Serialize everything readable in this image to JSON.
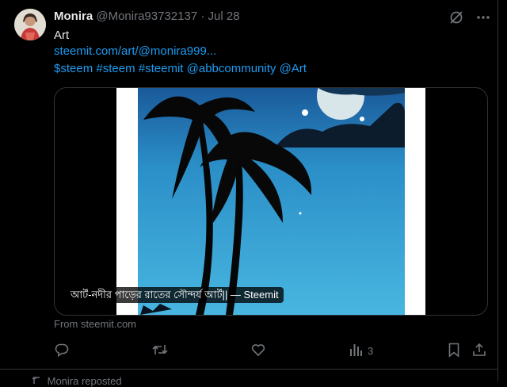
{
  "tweet": {
    "author_name": "Monira",
    "handle": "@Monira93732137",
    "separator": "·",
    "date": "Jul 28",
    "text": "Art",
    "link": "steemit.com/art/@monira999...",
    "tags": [
      "$steem",
      "#steem",
      "#steemit",
      "@abbcommunity",
      "@Art"
    ],
    "media_caption": "আর্ট-নদীর পাড়ের রাতের সৌন্দর্য আর্ট|| — Steemit",
    "from_text": "From steemit.com",
    "views": "3"
  },
  "next_item": {
    "text": "Monira reposted"
  },
  "colors": {
    "accent": "#1d9bf0",
    "muted": "#71767b",
    "text": "#e7e9ea",
    "background": "#000000"
  },
  "icons": {
    "top": [
      "grok-icon",
      "more-icon"
    ],
    "actions": [
      "reply-icon",
      "retweet-icon",
      "like-icon",
      "views-icon",
      "bookmark-icon",
      "share-icon"
    ]
  }
}
